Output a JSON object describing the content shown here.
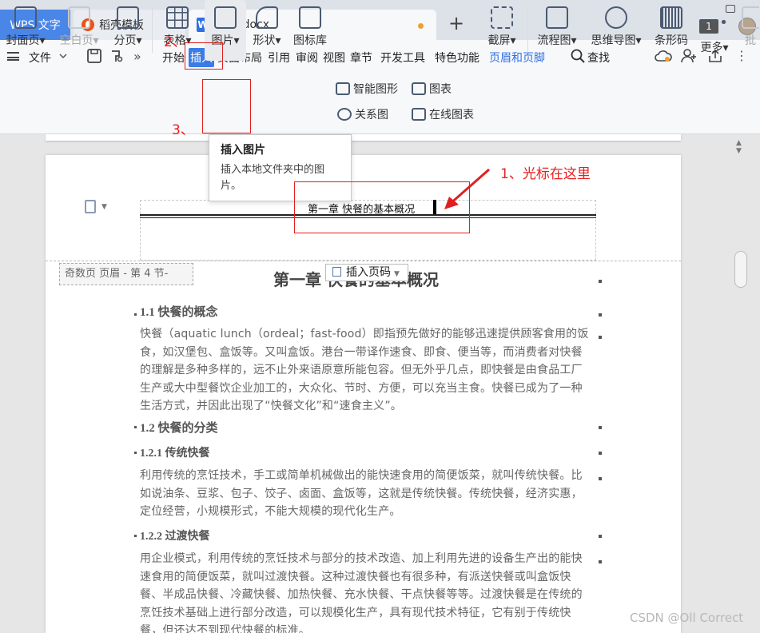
{
  "tabs": {
    "wps": "WPS 文字",
    "daoke": "稻壳模板",
    "doc": "WPS.docx",
    "add": "+",
    "window_count": "1"
  },
  "menu": {
    "file": "文件",
    "items": [
      "开始",
      "插入",
      "页面布局",
      "引用",
      "审阅",
      "视图",
      "章节",
      "开发工具",
      "特色功能",
      "页眉和页脚"
    ],
    "active_index": 1,
    "search": "查找"
  },
  "ribbon": {
    "cover": "封面页",
    "blank": "空白页",
    "break": "分页",
    "table": "表格",
    "picture": "图片",
    "shape": "形状",
    "icon_lib": "图标库",
    "smart_graphic": "智能图形",
    "chart": "图表",
    "relation": "关系图",
    "online_chart": "在线图表",
    "screenshot": "截屏",
    "flowchart": "流程图",
    "mindmap": "思维导图",
    "barcode": "条形码",
    "more": "更多",
    "annotate": "批"
  },
  "tooltip": {
    "title": "插入图片",
    "body": "插入本地文件夹中的图片。"
  },
  "header": {
    "text": "第一章 快餐的基本概况",
    "label": "奇数页 页眉 - 第 4 节-",
    "page_number_button": "插入页码"
  },
  "document": {
    "title": "第一章 快餐的基本概况",
    "s1_heading": "1.1 快餐的概念",
    "s1_para": "快餐（aquatic lunch（ordeal；fast-food）即指预先做好的能够迅速提供顾客食用的饭食，如汉堡包、盒饭等。又叫盒饭。港台一带译作速食、即食、便当等，而消费者对快餐的理解是多种多样的，远不止外来语原意所能包容。但无外乎几点，即快餐是由食品工厂生产或大中型餐饮企业加工的，大众化、节时、方便，可以充当主食。快餐已成为了一种生活方式，并因此出现了“快餐文化”和“速食主义”。",
    "s2_heading": "1.2 快餐的分类",
    "s21_heading": "1.2.1 传统快餐",
    "s21_para": "利用传统的烹饪技术，手工或简单机械做出的能快速食用的简便饭菜，就叫传统快餐。比如说油条、豆浆、包子、饺子、卤面、盒饭等，这就是传统快餐。传统快餐，经济实惠，定位经营，小规模形式，不能大规模的现代化生产。",
    "s22_heading": "1.2.2 过渡快餐",
    "s22_para": "用企业模式，利用传统的烹饪技术与部分的技术改造、加上利用先进的设备生产出的能快速食用的简便饭菜，就叫过渡快餐。这种过渡快餐也有很多种，有派送快餐或叫盒饭快餐、半成品快餐、冷藏快餐、加热快餐、充水快餐、干点快餐等等。过渡快餐是在传统的烹饪技术基础上进行部分改造，可以规模化生产，具有现代技术特征，它有别于传统快餐，但还达不到现代快餐的标准。"
  },
  "annotations": {
    "step1": "1、光标在这里",
    "step2": "2、",
    "step3": "3、"
  },
  "watermark": "CSDN @Oll Correct",
  "colors": {
    "accent": "#3a7ce6",
    "annotation_red": "#e02020",
    "wps_tab": "#4a86e8"
  }
}
